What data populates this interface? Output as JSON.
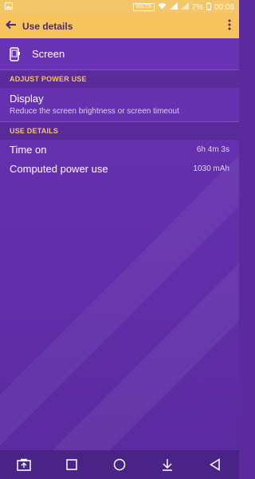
{
  "status_bar": {
    "volte": "VoLTE",
    "battery_percent": "7%",
    "time": "00:06",
    "icons": [
      "image-icon",
      "volte-icon",
      "wifi-icon",
      "signal-icon",
      "battery-icon"
    ]
  },
  "appbar": {
    "title": "Use details",
    "back_icon": "arrow-left-icon",
    "more_icon": "overflow-menu-icon"
  },
  "app": {
    "label": "Screen",
    "icon": "phone-icon"
  },
  "sections": {
    "adjust": {
      "header": "ADJUST POWER USE",
      "item": {
        "title": "Display",
        "summary": "Reduce the screen brightness or screen timeout"
      }
    },
    "use": {
      "header": "USE DETAILS",
      "rows": [
        {
          "label": "Time on",
          "value": "6h 4m 3s"
        },
        {
          "label": "Computed power use",
          "value": "1030 mAh"
        }
      ]
    }
  },
  "nav_bar": {
    "buttons": [
      "screenshot-icon",
      "recents-icon",
      "home-icon",
      "pull-down-icon",
      "back-icon"
    ]
  },
  "colors": {
    "accent": "#f6c35c",
    "background": "#6430ad",
    "nav": "#4a2386"
  }
}
